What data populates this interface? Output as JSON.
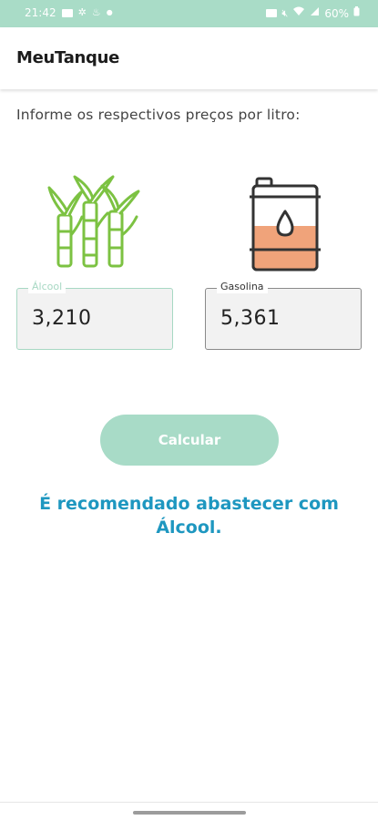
{
  "status_bar": {
    "time": "21:42",
    "battery": "60%",
    "left_icons": [
      "gallery-icon",
      "pinwheel-icon",
      "flame-icon",
      "dot-icon"
    ],
    "right_icons": [
      "nfc-icon",
      "mute-icon",
      "wifi-icon",
      "signal-icon",
      "battery-icon"
    ]
  },
  "app_bar": {
    "title": "MeuTanque"
  },
  "main": {
    "instruction": "Informe os respectivos preços por litro:",
    "images": {
      "alcool": "sugarcane-icon",
      "gasolina": "oil-barrel-icon"
    },
    "alcool_field": {
      "label": "Álcool",
      "value": "3,210"
    },
    "gasolina_field": {
      "label": "Gasolina",
      "value": "5,361"
    },
    "calcular_label": "Calcular",
    "result_line1": "É recomendado abastecer com",
    "result_line2": "Álcool."
  },
  "colors": {
    "accent": "#a8dbc7",
    "result_text": "#1e97c0",
    "barrel_fill": "#f0a37a"
  }
}
